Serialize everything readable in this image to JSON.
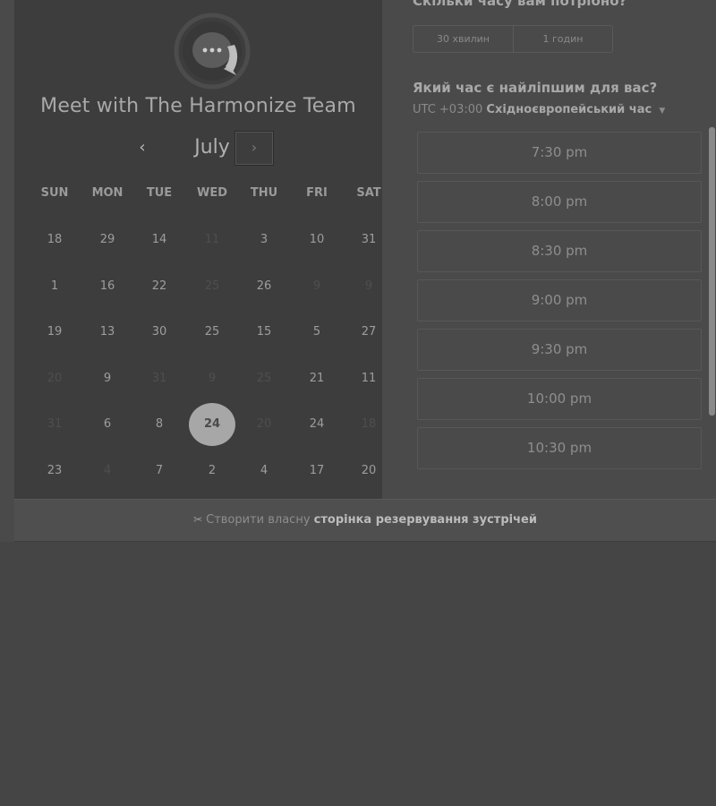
{
  "colors": {
    "background": "#454545",
    "calendar_bg": "#3d3d3d",
    "selected_day": "#a7a7a7"
  },
  "calendar": {
    "host_title": "Meet with The Harmonize Team",
    "month": "July",
    "prev_icon": "chevron-left-icon",
    "next_icon": "chevron-right-icon",
    "weekdays": [
      "SUN",
      "MON",
      "TUE",
      "WED",
      "THU",
      "FRI",
      "SAT"
    ],
    "weeks": [
      [
        {
          "label": "18",
          "disabled": false
        },
        {
          "label": "29",
          "disabled": false
        },
        {
          "label": "14",
          "disabled": false
        },
        {
          "label": "11",
          "disabled": true
        },
        {
          "label": "3",
          "disabled": false
        },
        {
          "label": "10",
          "disabled": false
        },
        {
          "label": "31",
          "disabled": false
        }
      ],
      [
        {
          "label": "1",
          "disabled": false
        },
        {
          "label": "16",
          "disabled": false
        },
        {
          "label": "22",
          "disabled": false
        },
        {
          "label": "25",
          "disabled": true
        },
        {
          "label": "26",
          "disabled": false
        },
        {
          "label": "9",
          "disabled": true
        },
        {
          "label": "9",
          "disabled": true
        }
      ],
      [
        {
          "label": "19",
          "disabled": false
        },
        {
          "label": "13",
          "disabled": false
        },
        {
          "label": "30",
          "disabled": false
        },
        {
          "label": "25",
          "disabled": false
        },
        {
          "label": "15",
          "disabled": false
        },
        {
          "label": "5",
          "disabled": false
        },
        {
          "label": "27",
          "disabled": false
        }
      ],
      [
        {
          "label": "20",
          "disabled": true
        },
        {
          "label": "9",
          "disabled": false
        },
        {
          "label": "31",
          "disabled": true
        },
        {
          "label": "9",
          "disabled": true
        },
        {
          "label": "25",
          "disabled": true
        },
        {
          "label": "21",
          "disabled": false
        },
        {
          "label": "11",
          "disabled": false
        }
      ],
      [
        {
          "label": "31",
          "disabled": true
        },
        {
          "label": "6",
          "disabled": false
        },
        {
          "label": "8",
          "disabled": false
        },
        {
          "label": "24",
          "disabled": false,
          "selected": true
        },
        {
          "label": "20",
          "disabled": true
        },
        {
          "label": "24",
          "disabled": false
        },
        {
          "label": "18",
          "disabled": true
        }
      ],
      [
        {
          "label": "23",
          "disabled": false
        },
        {
          "label": "4",
          "disabled": true
        },
        {
          "label": "7",
          "disabled": false
        },
        {
          "label": "2",
          "disabled": false
        },
        {
          "label": "4",
          "disabled": false
        },
        {
          "label": "17",
          "disabled": false
        },
        {
          "label": "20",
          "disabled": false
        }
      ]
    ]
  },
  "duration": {
    "question": "Скільки часу вам потрібно?",
    "options": [
      "30 хвилин",
      "1 годин"
    ]
  },
  "time": {
    "question": "Який час є найліпшим для вас?",
    "tz_offset": "UTC +03:00",
    "tz_name": "Східноєвропейський час",
    "slots": [
      "7:30 pm",
      "8:00 pm",
      "8:30 pm",
      "9:00 pm",
      "9:30 pm",
      "10:00 pm",
      "10:30 pm"
    ]
  },
  "footer": {
    "prefix": "Створити власну",
    "link": "сторінка резервування зустрічей",
    "icon": "scissors-icon"
  }
}
